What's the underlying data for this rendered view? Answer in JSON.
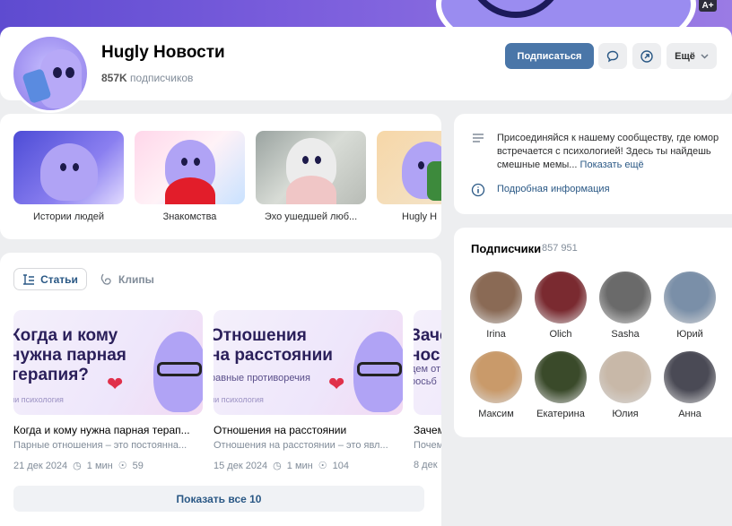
{
  "header": {
    "title": "Hugly Новости",
    "subscribers_count": "857K",
    "subscribers_label": "подписчиков",
    "subscribe_button": "Подписаться",
    "more_button": "Ещё",
    "font_size_badge": "A+"
  },
  "stories": [
    {
      "label": "Истории людей"
    },
    {
      "label": "Знакомства"
    },
    {
      "label": "Эхо ушедшей люб..."
    },
    {
      "label": "Hugly Н"
    }
  ],
  "articles_section": {
    "tabs": [
      {
        "label": "Статьи",
        "active": true
      },
      {
        "label": "Клипы",
        "active": false
      }
    ],
    "articles": [
      {
        "image_headline_1": "Когда и кому",
        "image_headline_2": "нужна парная",
        "image_headline_3": "терапия?",
        "image_category": "ли психология",
        "title": "Когда и кому нужна парная терап...",
        "description": "Парные отношения – это постоянна...",
        "date": "21 дек 2024",
        "read_time": "1 мин",
        "views": "59"
      },
      {
        "image_headline_1": "Отношения",
        "image_headline_2": "на расстоянии",
        "image_subheadline": "равные противоречия",
        "image_category": "ли психология",
        "title": "Отношения на расстоянии",
        "description": "Отношения на расстоянии – это явл...",
        "date": "15 дек 2024",
        "read_time": "1 мин",
        "views": "104"
      },
      {
        "image_headline_1": "Зачем",
        "image_headline_2": "нос",
        "image_subheadline": "дем от",
        "image_subheadline_2": "росьб",
        "title": "Зачем",
        "description": "Почем",
        "date": "8 дек"
      }
    ],
    "show_all_button": "Показать все 10"
  },
  "about": {
    "description": "Присоединяйся к нашему сообществу, где юмор встречается с психологией! Здесь ты найдешь смешные мемы...",
    "show_more": "Показать ещё",
    "info_link": "Подробная информация"
  },
  "subscribers": {
    "heading": "Подписчики",
    "count": "857 951",
    "people": [
      {
        "name": "Irina",
        "color": "#8a6a55"
      },
      {
        "name": "Olich",
        "color": "#7a2a30"
      },
      {
        "name": "Sasha",
        "color": "#6a6a6a"
      },
      {
        "name": "Юрий",
        "color": "#7a8fa8"
      },
      {
        "name": "Максим",
        "color": "#c99a6a"
      },
      {
        "name": "Екатерина",
        "color": "#3a4a2a"
      },
      {
        "name": "Юлия",
        "color": "#c8b8a8"
      },
      {
        "name": "Анна",
        "color": "#4a4a55"
      }
    ]
  },
  "colors": {
    "accent": "#4a76a8",
    "link": "#2a5885",
    "secondary_text": "#818c99",
    "background": "#edeef0"
  }
}
